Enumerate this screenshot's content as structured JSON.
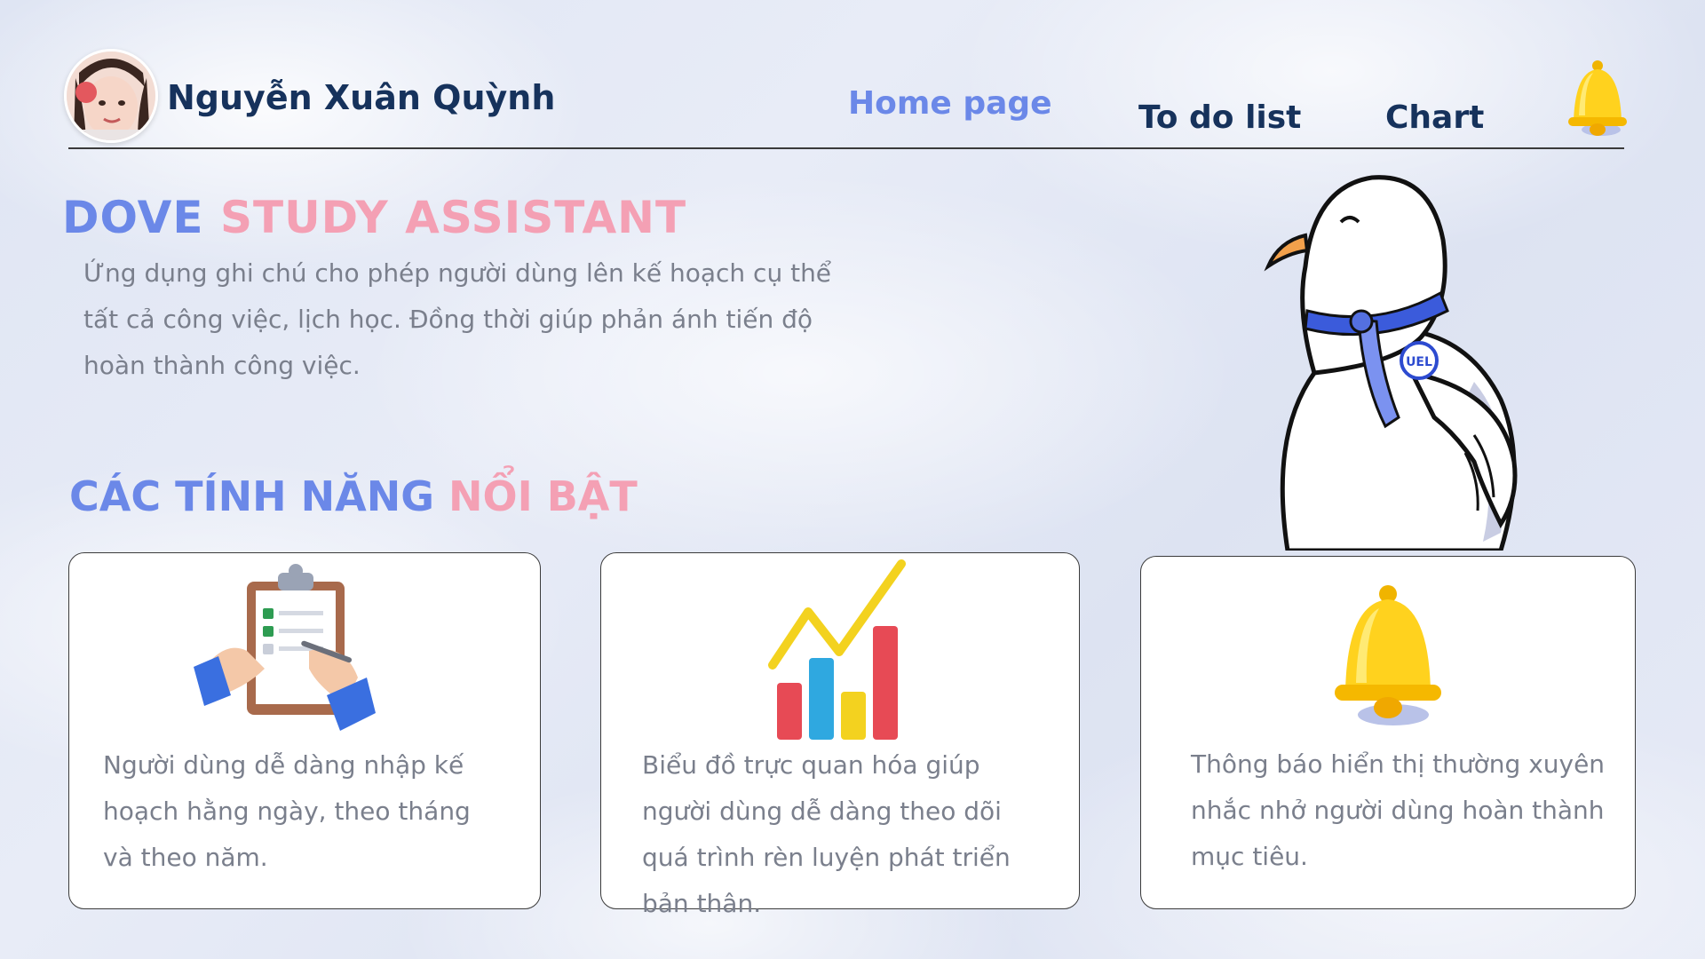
{
  "header": {
    "user_name": "Nguyễn Xuân Quỳnh",
    "nav": {
      "home": "Home page",
      "todo": "To do list",
      "chart": "Chart"
    }
  },
  "hero": {
    "title_part1": "DOVE",
    "title_part2": "STUDY ASSISTANT",
    "description": "Ứng dụng ghi chú cho phép người dùng lên kế hoạch cụ thể tất cả công việc, lịch học. Đồng thời giúp phản ánh tiến độ hoàn thành công việc."
  },
  "features": {
    "title_part1": "CÁC TÍNH NĂNG",
    "title_part2": "NỔI BẬT",
    "cards": [
      {
        "icon": "clipboard-icon",
        "text": "Người dùng dễ dàng nhập kế hoạch hằng ngày, theo tháng và theo năm."
      },
      {
        "icon": "bar-chart-icon",
        "text": "Biểu đồ trực quan hóa giúp người dùng dễ dàng theo dõi quá trình rèn luyện phát triển bản thân."
      },
      {
        "icon": "bell-icon",
        "text": "Thông báo hiển thị thường xuyên nhắc nhở người dùng hoàn thành mục tiêu."
      }
    ]
  },
  "colors": {
    "accent_blue": "#6b88e8",
    "accent_pink": "#f4a0b4",
    "navy": "#16325c",
    "body_text": "#7a7f8c"
  },
  "mascot_badge": "UEL"
}
